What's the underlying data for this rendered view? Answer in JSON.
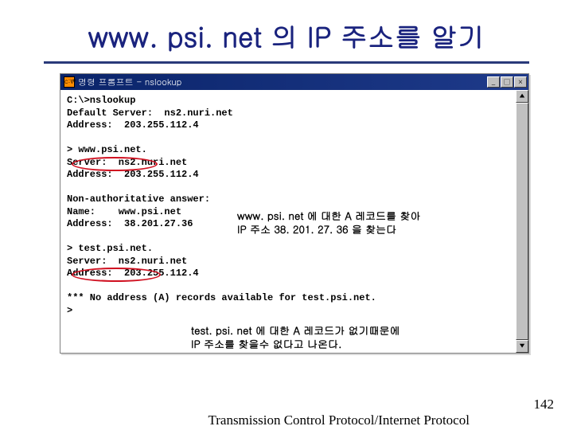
{
  "slide": {
    "title": "www. psi. net 의 IP 주소를 알기"
  },
  "window": {
    "title": "명령 프롬프트 - nslookup"
  },
  "terminal": {
    "lines": "C:\\>nslookup\nDefault Server:  ns2.nuri.net\nAddress:  203.255.112.4\n\n> www.psi.net.\nServer:  ns2.nuri.net\nAddress:  203.255.112.4\n\nNon-authoritative answer:\nName:    www.psi.net\nAddress:  38.201.27.36\n\n> test.psi.net.\nServer:  ns2.nuri.net\nAddress:  203.255.112.4\n\n*** No address (A) records available for test.psi.net.\n>"
  },
  "annotations": {
    "a1_line1": "www. psi. net 에 대한 A 레코드를 찾아",
    "a1_line2": "IP 주소 38. 201. 27. 36 을 찾는다",
    "a2_line1": "test. psi. net 에 대한 A 레코드가 없기때문에",
    "a2_line2": "IP 주소를 찾을수 없다고 나온다."
  },
  "footer": {
    "text": "Transmission Control Protocol/Internet Protocol",
    "page": "142"
  },
  "icons": {
    "minimize": "_",
    "maximize": "□",
    "close": "×",
    "up": "▲",
    "down": "▼"
  }
}
